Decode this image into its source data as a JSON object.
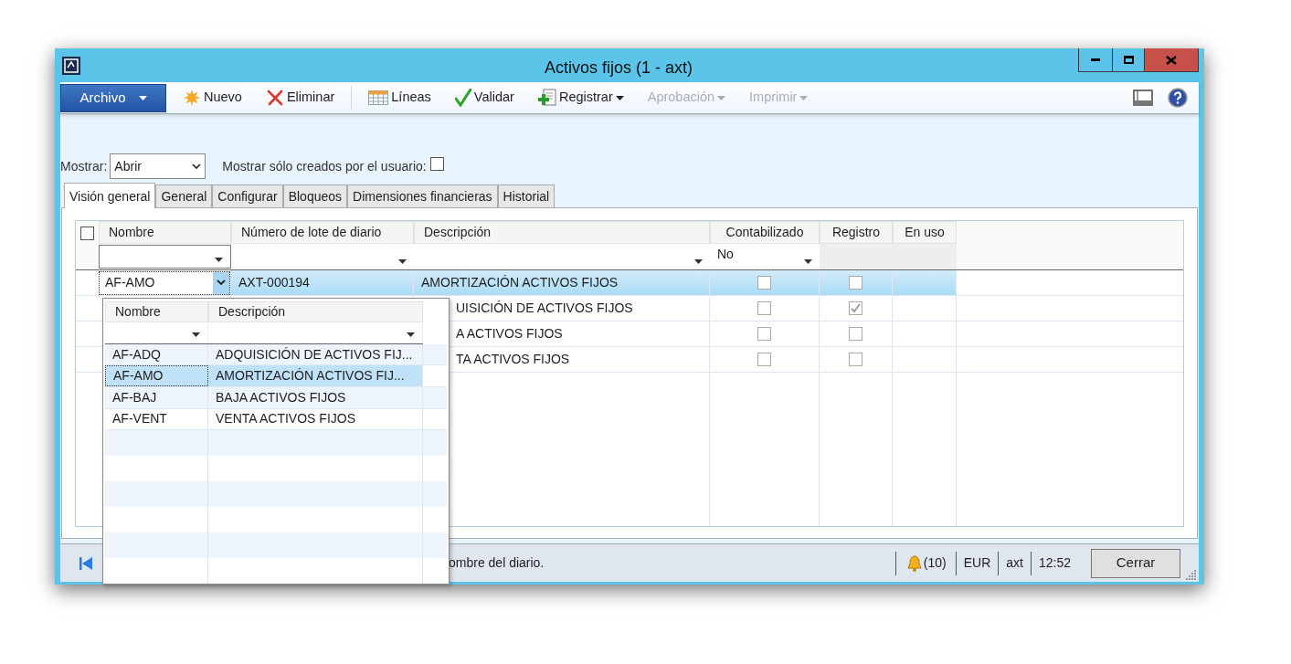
{
  "window": {
    "title": "Activos fijos (1 - axt)"
  },
  "toolbar": {
    "file_menu": "Archivo",
    "groups": [
      {
        "buttons": [
          {
            "label": "Nuevo",
            "kind": "new",
            "disabled": false,
            "has_menu": false
          },
          {
            "label": "Eliminar",
            "kind": "delete",
            "disabled": false,
            "has_menu": false
          }
        ]
      },
      {
        "buttons": [
          {
            "label": "Líneas",
            "kind": "lines",
            "disabled": false,
            "has_menu": false
          },
          {
            "label": "Validar",
            "kind": "validate",
            "disabled": false,
            "has_menu": false
          },
          {
            "label": "Registrar",
            "kind": "post",
            "disabled": false,
            "has_menu": true
          },
          {
            "label": "Aprobación",
            "kind": "text",
            "disabled": true,
            "has_menu": true
          },
          {
            "label": "Imprimir",
            "kind": "text",
            "disabled": true,
            "has_menu": true
          }
        ]
      }
    ]
  },
  "filter": {
    "label": "Mostrar:",
    "value": "Abrir",
    "user_only_label": "Mostrar sólo creados por el usuario:",
    "user_only_checked": false
  },
  "tabs": [
    {
      "label": "Visión general",
      "selected": true
    },
    {
      "label": "General",
      "selected": false
    },
    {
      "label": "Configurar",
      "selected": false
    },
    {
      "label": "Bloqueos",
      "selected": false
    },
    {
      "label": "Dimensiones financieras",
      "selected": false
    },
    {
      "label": "Historial",
      "selected": false
    }
  ],
  "grid": {
    "all_checked": false,
    "columns": [
      {
        "label": "Nombre",
        "filterable": true
      },
      {
        "label": "Número de lote de diario",
        "filterable": true
      },
      {
        "label": "Descripción",
        "filterable": true
      },
      {
        "label": "Contabilizado",
        "filterable": true,
        "filter_value": "No"
      },
      {
        "label": "Registro",
        "filterable": false
      },
      {
        "label": "En uso",
        "filterable": false
      }
    ],
    "rows": [
      {
        "name": "AF-AMO",
        "batch": "AXT-000194",
        "description": "AMORTIZACIÓN ACTIVOS FIJOS",
        "posted": false,
        "register": false,
        "selected": true
      },
      {
        "description": "UISICIÓN DE ACTIVOS FIJOS",
        "posted": false,
        "register": true,
        "selected": false
      },
      {
        "description": "A ACTIVOS FIJOS",
        "posted": false,
        "register": false,
        "selected": false
      },
      {
        "description": "TA ACTIVOS FIJOS",
        "posted": false,
        "register": false,
        "selected": false
      }
    ]
  },
  "lookup": {
    "columns": [
      "Nombre",
      "Descripción"
    ],
    "rows": [
      {
        "name": "AF-ADQ",
        "description": "ADQUISICIÓN DE ACTIVOS FIJ...",
        "selected": false
      },
      {
        "name": "AF-AMO",
        "description": "AMORTIZACIÓN ACTIVOS FIJ...",
        "selected": true
      },
      {
        "name": "AF-BAJ",
        "description": "BAJA ACTIVOS FIJOS",
        "selected": false
      },
      {
        "name": "AF-VENT",
        "description": "VENTA ACTIVOS FIJOS",
        "selected": false
      }
    ]
  },
  "status_bar": {
    "message": "ombre del diario.",
    "notifications": "(10)",
    "currency": "EUR",
    "company": "axt",
    "time": "12:52",
    "close_button": "Cerrar"
  }
}
